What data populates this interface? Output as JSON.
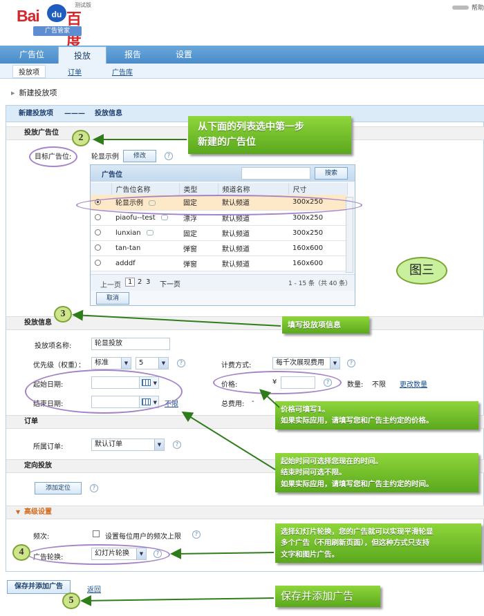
{
  "header": {
    "logo_text": "Bai",
    "logo_paw": "du",
    "logo_cn": "百度",
    "logo_test": "测试版",
    "logo_sub": "广告管家",
    "help": "帮助"
  },
  "nav": {
    "tabs": [
      "广告位",
      "投放",
      "报告",
      "设置"
    ],
    "active": 1
  },
  "subnav": {
    "items": [
      "投放项",
      "订单",
      "广告库"
    ],
    "current": 0
  },
  "breadcrumb": "新建投放项",
  "stepbar": {
    "step1": "新建投放项",
    "sep": "———",
    "step2": "投放信息"
  },
  "section_placement": {
    "title": "投放广告位",
    "target_label": "目标广告位:",
    "target_value": "轮显示例",
    "modify_button": "修改",
    "picker": {
      "title": "广告位",
      "search_button": "搜索",
      "search_placeholder": "",
      "columns": [
        "广告位名称",
        "类型",
        "频道名称",
        "尺寸"
      ],
      "rows": [
        {
          "name": "轮显示例",
          "type": "固定",
          "channel": "默认频道",
          "size": "300x250",
          "selected": true
        },
        {
          "name": "piaofu--test",
          "type": "漂浮",
          "channel": "默认频道",
          "size": "300x250",
          "selected": false
        },
        {
          "name": "lunxian",
          "type": "固定",
          "channel": "默认频道",
          "size": "300x250",
          "selected": false
        },
        {
          "name": "tan-tan",
          "type": "弹窗",
          "channel": "默认频道",
          "size": "160x600",
          "selected": false
        },
        {
          "name": "adddf",
          "type": "弹窗",
          "channel": "默认频道",
          "size": "160x600",
          "selected": false
        }
      ],
      "pager": {
        "prev": "上一页",
        "pages": [
          "1",
          "2",
          "3"
        ],
        "next": "下一页",
        "range": "1 - 15 条（共 40 条）"
      },
      "cancel_button": "取消"
    }
  },
  "section_info": {
    "title": "投放信息",
    "name_label": "投放项名称:",
    "name_value": "轮显投放",
    "priority_label": "优先级（权重）：",
    "priority_value": "标准",
    "weight_value": "5",
    "billing_label": "计费方式:",
    "billing_value": "每千次展现费用",
    "start_label": "起始日期:",
    "end_label": "结束日期:",
    "unlimited": "不限",
    "price_label": "价格:",
    "currency": "¥",
    "qty_label": "数量:",
    "qty_value": "不限",
    "change_qty": "更改数量",
    "total_label": "总费用:",
    "total_value": "-"
  },
  "section_order": {
    "title": "订单",
    "order_label": "所属订单:",
    "order_value": "默认订单"
  },
  "section_target": {
    "title": "定向投放",
    "add_button": "添加定位"
  },
  "section_advanced": {
    "title": "高级设置",
    "freq_label": "频次:",
    "freq_check": "设置每位用户的频次上限",
    "rotate_label": "广告轮换:",
    "rotate_value": "幻灯片轮换"
  },
  "footer": {
    "save_button": "保存并添加广告",
    "back_link": "返回"
  },
  "annotations": {
    "callout1": [
      "从下面的列表选中第一步",
      "新建的广告位"
    ],
    "callout2": "填写投放项信息",
    "callout3": [
      "价格可填写1。",
      "如果实际应用，请填写您和广告主约定的价格。"
    ],
    "callout4": [
      "起始时间可选择您现在的时间。",
      "结束时间可选不限。",
      "如果实际应用，请填写您和广告主约定的时间。"
    ],
    "callout5": [
      "选择幻灯片轮换，您的广告就可以实现平滑轮显",
      "多个广告（不用刷新页面），但这种方式只支持",
      "文字和图片广告。"
    ],
    "callout6": "保存并添加广告",
    "figure": "图三",
    "numbers": [
      "2",
      "3",
      "4",
      "5"
    ]
  },
  "colors": {
    "nav": "#4a8bc9",
    "callout": "#6cbf24",
    "ellipse": "#a484c8",
    "arrow": "#2f7d1a"
  }
}
